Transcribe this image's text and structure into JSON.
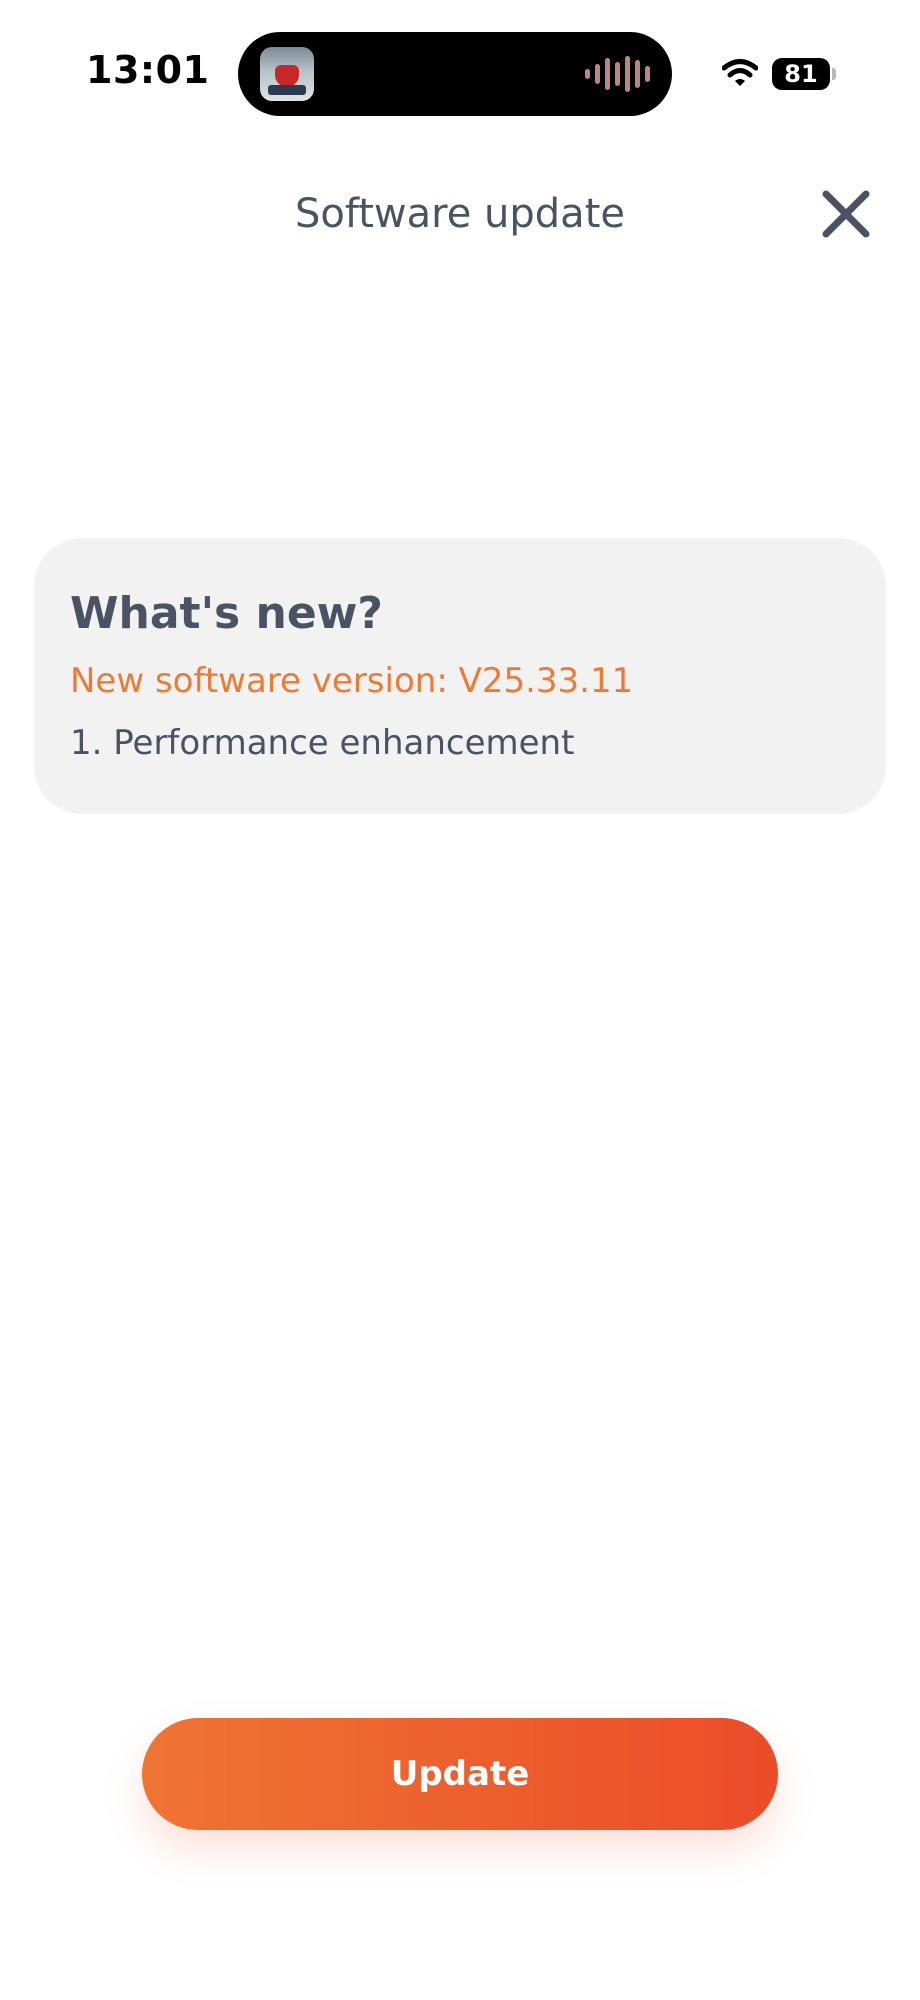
{
  "status_bar": {
    "time": "13:01",
    "battery_level": "81",
    "wifi_icon": "wifi-icon",
    "now_playing_icon": "audio-waveform-icon"
  },
  "header": {
    "title": "Software update",
    "close_icon": "close-icon"
  },
  "whats_new": {
    "heading": "What's new?",
    "version_line": "New software version: V25.33.11",
    "items": [
      "1. Performance enhancement"
    ]
  },
  "actions": {
    "update_label": "Update"
  },
  "colors": {
    "accent": "#ee7a33",
    "button_gradient_start": "#ef7432",
    "button_gradient_end": "#eb4c29",
    "text_primary": "#4a5263",
    "card_background": "#f2f2f2"
  }
}
